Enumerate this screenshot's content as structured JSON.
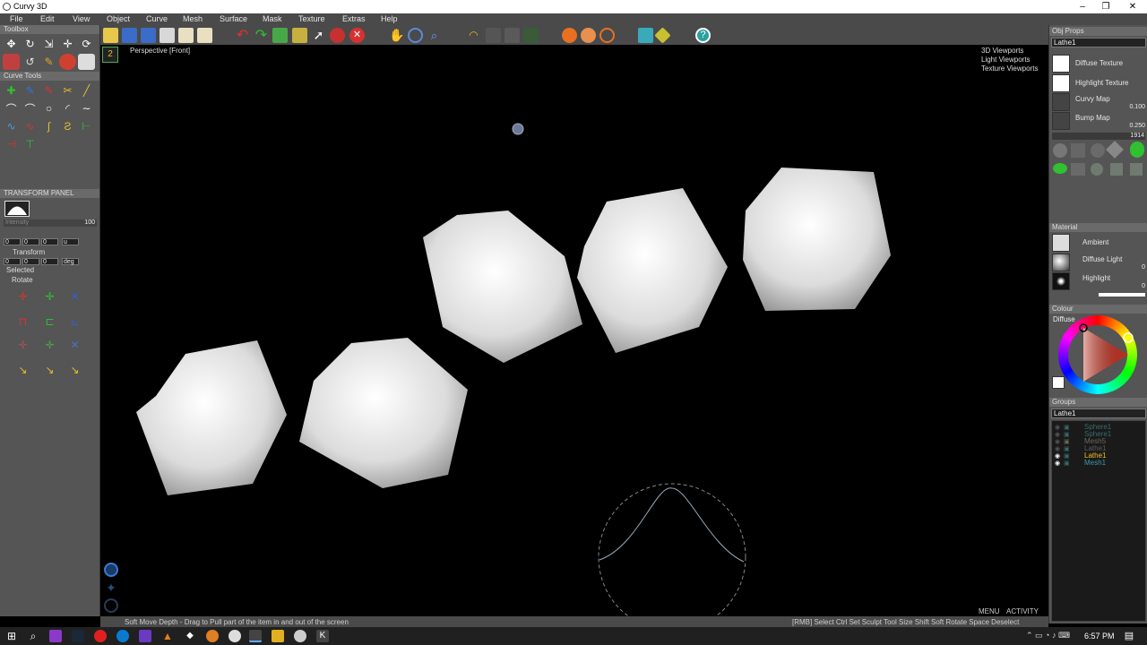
{
  "window": {
    "title": "Curvy 3D",
    "min": "–",
    "max": "❐",
    "close": "✕"
  },
  "menu": [
    "File",
    "Edit",
    "View",
    "Object",
    "Curve",
    "Mesh",
    "Surface",
    "Mask",
    "Texture",
    "Extras",
    "Help"
  ],
  "toolbar": {
    "icons": [
      "open-folder-icon",
      "save-icon",
      "save-as-icon",
      "import-icon",
      "export-icon",
      "export-2-icon",
      "undo-icon",
      "redo-icon",
      "new-object-icon",
      "copy-icon",
      "select-arrow-icon",
      "delete-object-icon",
      "delete-icon",
      "pan-hand-icon",
      "orbit-icon",
      "zoom-icon",
      "light-icon",
      "sculpt-brush-icon",
      "view-front-icon",
      "grid-toggle-icon",
      "sphere-render-icon",
      "sphere-wire-icon",
      "sphere-mesh-icon",
      "grid-view-icon",
      "snap-icon",
      "help-icon"
    ],
    "viewport_label": "Perspective [Front]",
    "view_number": "2"
  },
  "left": {
    "toolbox_title": "Toolbox",
    "curve_tools_title": "Curve Tools",
    "transform_panel_title": "TRANSFORM   PANEL",
    "intensity_label": "Intensity",
    "intensity_value": "100",
    "pos": [
      "0",
      "0",
      "0"
    ],
    "pos_unit": "u",
    "transform_label": "Transform",
    "rot": [
      "0",
      "0",
      "0"
    ],
    "rot_unit": "deg",
    "selected_label": "Selected",
    "rotate_label": "Rotate"
  },
  "viewport": {
    "links": [
      "3D Viewports",
      "Light Viewports",
      "Texture Viewports"
    ],
    "menu_label": "MENU",
    "activity_label": "ACTIVITY"
  },
  "right": {
    "obj_props_title": "Obj Props",
    "object_name": "Lathe1",
    "diffuse_texture": "Diffuse Texture",
    "highlight_texture": "Highlight Texture",
    "curvy_map": "Curvy Map",
    "curvy_map_value": "0.100",
    "bump_map": "Bump Map",
    "bump_map_value": "0.250",
    "resolution_value": "1914",
    "material_title": "Material",
    "ambient": "Ambient",
    "diffuse_light": "Diffuse Light",
    "diffuse_light_value": "0",
    "highlight": "Highlight",
    "highlight_value": "0",
    "colour_title": "Colour",
    "colour_mode": "Diffuse",
    "groups_title": "Groups",
    "group_current": "Lathe1",
    "groups": [
      {
        "name": "Sphere1",
        "color": "#3a6b6b"
      },
      {
        "name": "Sphere1",
        "color": "#3a6b6b"
      },
      {
        "name": "Mesh5",
        "color": "#6b6b5a"
      },
      {
        "name": "Lathe1",
        "color": "#5a5a5a"
      },
      {
        "name": "Lathe1",
        "color": "#f0c020"
      },
      {
        "name": "Mesh1",
        "color": "#3a9aaa"
      }
    ]
  },
  "status": {
    "left": "Soft Move Depth - Drag to Pull part of the item in and out of the screen",
    "right": "[RMB] Select   Ctrl  Set Sculpt Tool Size   Shift  Soft Rotate   Space  Deselect"
  },
  "taskbar": {
    "time": "6:57 PM"
  },
  "colors": {
    "accent": "#ffd000",
    "panel": "#555555",
    "viewport": "#000000"
  }
}
